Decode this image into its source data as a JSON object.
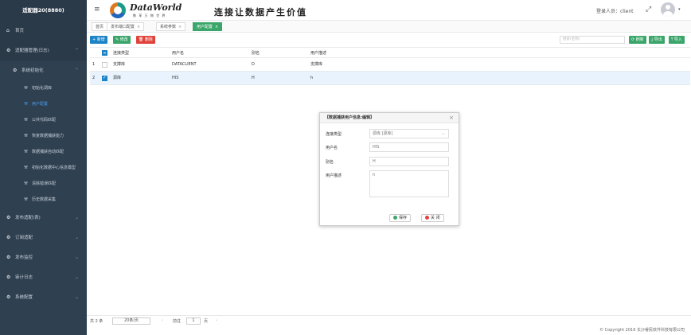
{
  "app": {
    "title": "适配器20(8880)",
    "logo_text": "DataWorld",
    "logo_sub": "数 享 万 物 世 界",
    "slogan": "连接让数据产生价值",
    "login_user": "登录人员：client"
  },
  "sidebar": {
    "items": [
      {
        "label": "首页",
        "icon": "home-icon"
      },
      {
        "label": "适配器管理(日志)",
        "icon": "gear-icon"
      },
      {
        "label": "系统初始化",
        "icon": "gear-icon"
      },
      {
        "label": "发布适配(表)",
        "icon": "gear-icon"
      },
      {
        "label": "订阅适配",
        "icon": "gear-icon"
      },
      {
        "label": "发布监控",
        "icon": "gear-icon"
      },
      {
        "label": "审计日志",
        "icon": "gear-icon"
      },
      {
        "label": "系统配置",
        "icon": "gear-icon"
      }
    ],
    "subitems": [
      {
        "label": "初始化调库",
        "icon": "wrench-icon"
      },
      {
        "label": "用户配置",
        "icon": "wrench-icon",
        "active": true
      },
      {
        "label": "公共代码匹配",
        "icon": "wrench-icon"
      },
      {
        "label": "恢复数据捕获能力",
        "icon": "wrench-icon"
      },
      {
        "label": "数据捕获自动匹配",
        "icon": "wrench-icon"
      },
      {
        "label": "初始化数据中心信息模型",
        "icon": "wrench-icon"
      },
      {
        "label": "清除错误匹配",
        "icon": "wrench-icon"
      },
      {
        "label": "历史数据采集",
        "icon": "wrench-icon"
      }
    ]
  },
  "tabs": [
    {
      "label": "首页"
    },
    {
      "label": "发布端口配置"
    },
    {
      "label": "系统参数"
    },
    {
      "label": "用户配置",
      "active": true
    }
  ],
  "toolbar": {
    "add_label": "+ 新增",
    "edit_label": "✎ 修改",
    "delete_label": "🗑 删除",
    "search_placeholder": "搜索(名称)",
    "refresh_label": "⟳ 刷新",
    "export_label": "⤓ 导出",
    "import_label": "⤒ 导入"
  },
  "table": {
    "columns": [
      "连接类型",
      "用户名",
      "别名",
      "用户描述"
    ],
    "rows": [
      {
        "num": "1",
        "type": "支撑库",
        "user": "DATACLIENT",
        "alias": "D",
        "desc": "支撑库",
        "checked": false
      },
      {
        "num": "2",
        "type": "源库",
        "user": "HIS",
        "alias": "H",
        "desc": "h",
        "checked": true
      }
    ]
  },
  "pager": {
    "total": "共 2 条",
    "page_size": "20条/页",
    "goto_label": "前往",
    "page": "1",
    "page_unit": "页",
    "prev": "‹",
    "next": "›"
  },
  "copyright": "© Copyright 2016 长沙睿民软件科技有限公司",
  "modal": {
    "title": "【数据捕获用户信息:编辑】",
    "type_label": "连接类型",
    "type_value": "源库 [源库]",
    "user_label": "用户名",
    "user_value": "HIS",
    "alias_label": "别名",
    "alias_value": "H",
    "desc_label": "用户描述",
    "desc_value": "h",
    "save_label": "保存",
    "close_label": "关 闭",
    "close_x": "×"
  },
  "colors": {
    "sidebar_bg": "#2f4050",
    "accent_blue": "#1c84c6",
    "accent_green": "#3aa66a",
    "danger_red": "#e0433b"
  }
}
